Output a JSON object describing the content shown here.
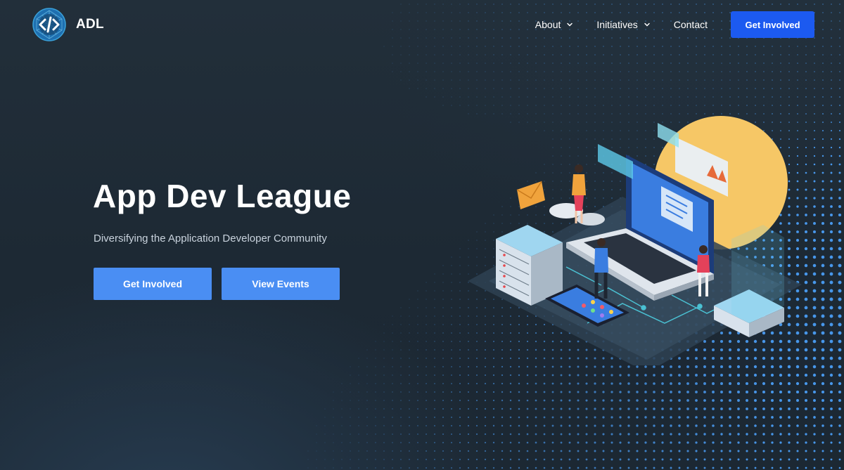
{
  "header": {
    "brand_name": "ADL",
    "nav": [
      {
        "label": "About",
        "has_dropdown": true
      },
      {
        "label": "Initiatives",
        "has_dropdown": true
      },
      {
        "label": "Contact",
        "has_dropdown": false
      }
    ],
    "cta_label": "Get Involved"
  },
  "hero": {
    "title": "App Dev League",
    "subtitle": "Diversifying the Application Developer Community",
    "buttons": [
      {
        "label": "Get Involved"
      },
      {
        "label": "View Events"
      }
    ]
  },
  "colors": {
    "background": "#1f2b36",
    "nav_button": "#1c5af0",
    "hero_button": "#4a8ef3",
    "dots": "#4da3ff"
  },
  "icons": {
    "logo": "code-brackets-globe-icon",
    "dropdown": "chevron-down-icon"
  }
}
